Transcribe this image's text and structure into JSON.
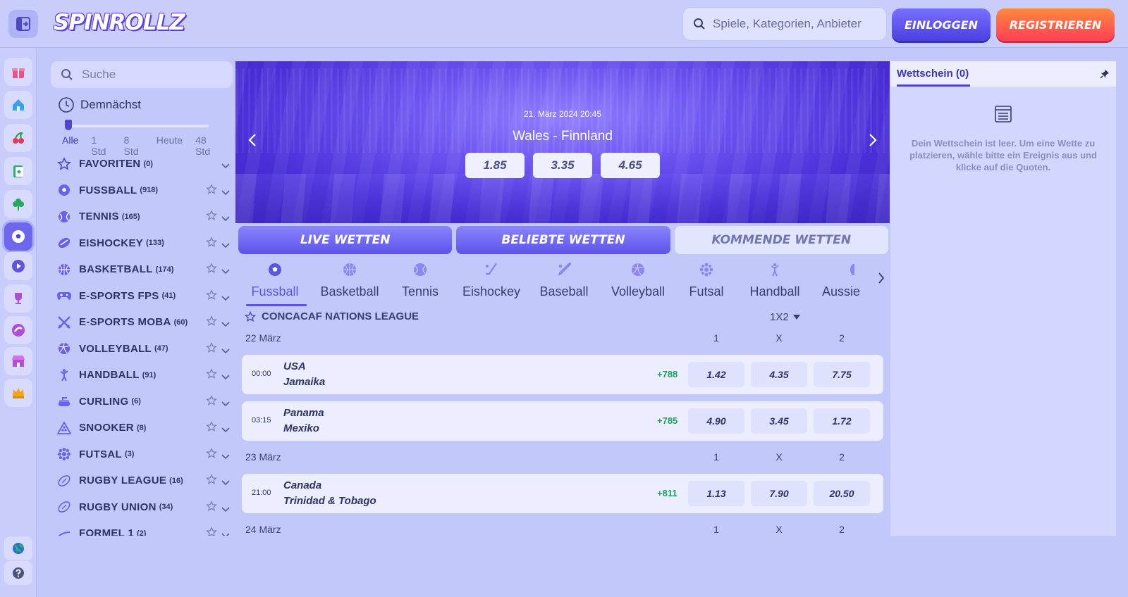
{
  "header": {
    "logo": "SPINROLLZ",
    "search_placeholder": "Spiele, Kategorien, Anbieter",
    "login_label": "EINLOGGEN",
    "register_label": "REGISTRIEREN"
  },
  "sidebar": {
    "search_placeholder": "Suche",
    "upcoming_label": "Demnächst",
    "time_filters": [
      "Alle",
      "1 Std",
      "8 Std",
      "Heute",
      "48 Std"
    ],
    "sports": [
      {
        "name": "FAVORITEN",
        "count": "(0)",
        "icon": "star-icon"
      },
      {
        "name": "FUSSBALL",
        "count": "(918)",
        "icon": "soccer-ball-icon"
      },
      {
        "name": "TENNIS",
        "count": "(165)",
        "icon": "tennis-ball-icon"
      },
      {
        "name": "EISHOCKEY",
        "count": "(133)",
        "icon": "puck-icon"
      },
      {
        "name": "BASKETBALL",
        "count": "(174)",
        "icon": "basketball-icon"
      },
      {
        "name": "E-SPORTS FPS",
        "count": "(41)",
        "icon": "gamepad-icon"
      },
      {
        "name": "E-SPORTS MOBA",
        "count": "(60)",
        "icon": "swords-icon"
      },
      {
        "name": "VOLLEYBALL",
        "count": "(47)",
        "icon": "volleyball-icon"
      },
      {
        "name": "HANDBALL",
        "count": "(91)",
        "icon": "handball-icon"
      },
      {
        "name": "CURLING",
        "count": "(6)",
        "icon": "curling-stone-icon"
      },
      {
        "name": "SNOOKER",
        "count": "(8)",
        "icon": "snooker-icon"
      },
      {
        "name": "FUTSAL",
        "count": "(3)",
        "icon": "futsal-ball-icon"
      },
      {
        "name": "RUGBY LEAGUE",
        "count": "(16)",
        "icon": "rugby-ball-icon"
      },
      {
        "name": "RUGBY UNION",
        "count": "(34)",
        "icon": "rugby-ball-icon"
      },
      {
        "name": "FORMEL 1",
        "count": "(2)",
        "icon": "racing-icon"
      }
    ]
  },
  "banner": {
    "date": "21. März 2024 20:45",
    "match": "Wales  -  Finnland",
    "odds": [
      "1.85",
      "3.35",
      "4.65"
    ]
  },
  "bet_tabs": [
    "LIVE WETTEN",
    "BELIEBTE WETTEN",
    "KOMMENDE WETTEN"
  ],
  "categories": [
    "Fussball",
    "Basketball",
    "Tennis",
    "Eishockey",
    "Baseball",
    "Volleyball",
    "Futsal",
    "Handball",
    "Aussie"
  ],
  "league": {
    "name": "CONCACAF NATIONS LEAGUE",
    "market": "1X2",
    "columns": [
      "1",
      "X",
      "2"
    ]
  },
  "days": [
    {
      "date": "22 März",
      "matches": [
        {
          "time": "00:00",
          "home": "USA",
          "away": "Jamaika",
          "more": "+788",
          "odds": [
            "1.42",
            "4.35",
            "7.75"
          ]
        },
        {
          "time": "03:15",
          "home": "Panama",
          "away": "Mexiko",
          "more": "+785",
          "odds": [
            "4.90",
            "3.45",
            "1.72"
          ]
        }
      ]
    },
    {
      "date": "23 März",
      "matches": [
        {
          "time": "21:00",
          "home": "Canada",
          "away": "Trinidad & Tobago",
          "more": "+811",
          "odds": [
            "1.13",
            "7.90",
            "20.50"
          ]
        }
      ]
    },
    {
      "date": "24 März",
      "matches": []
    }
  ],
  "betslip": {
    "title": "Wettschein (0)",
    "empty_text": "Dein Wettschein ist leer. Um eine Wette zu platzieren, wähle bitte ein Ereignis aus und klicke auf die Quoten."
  }
}
